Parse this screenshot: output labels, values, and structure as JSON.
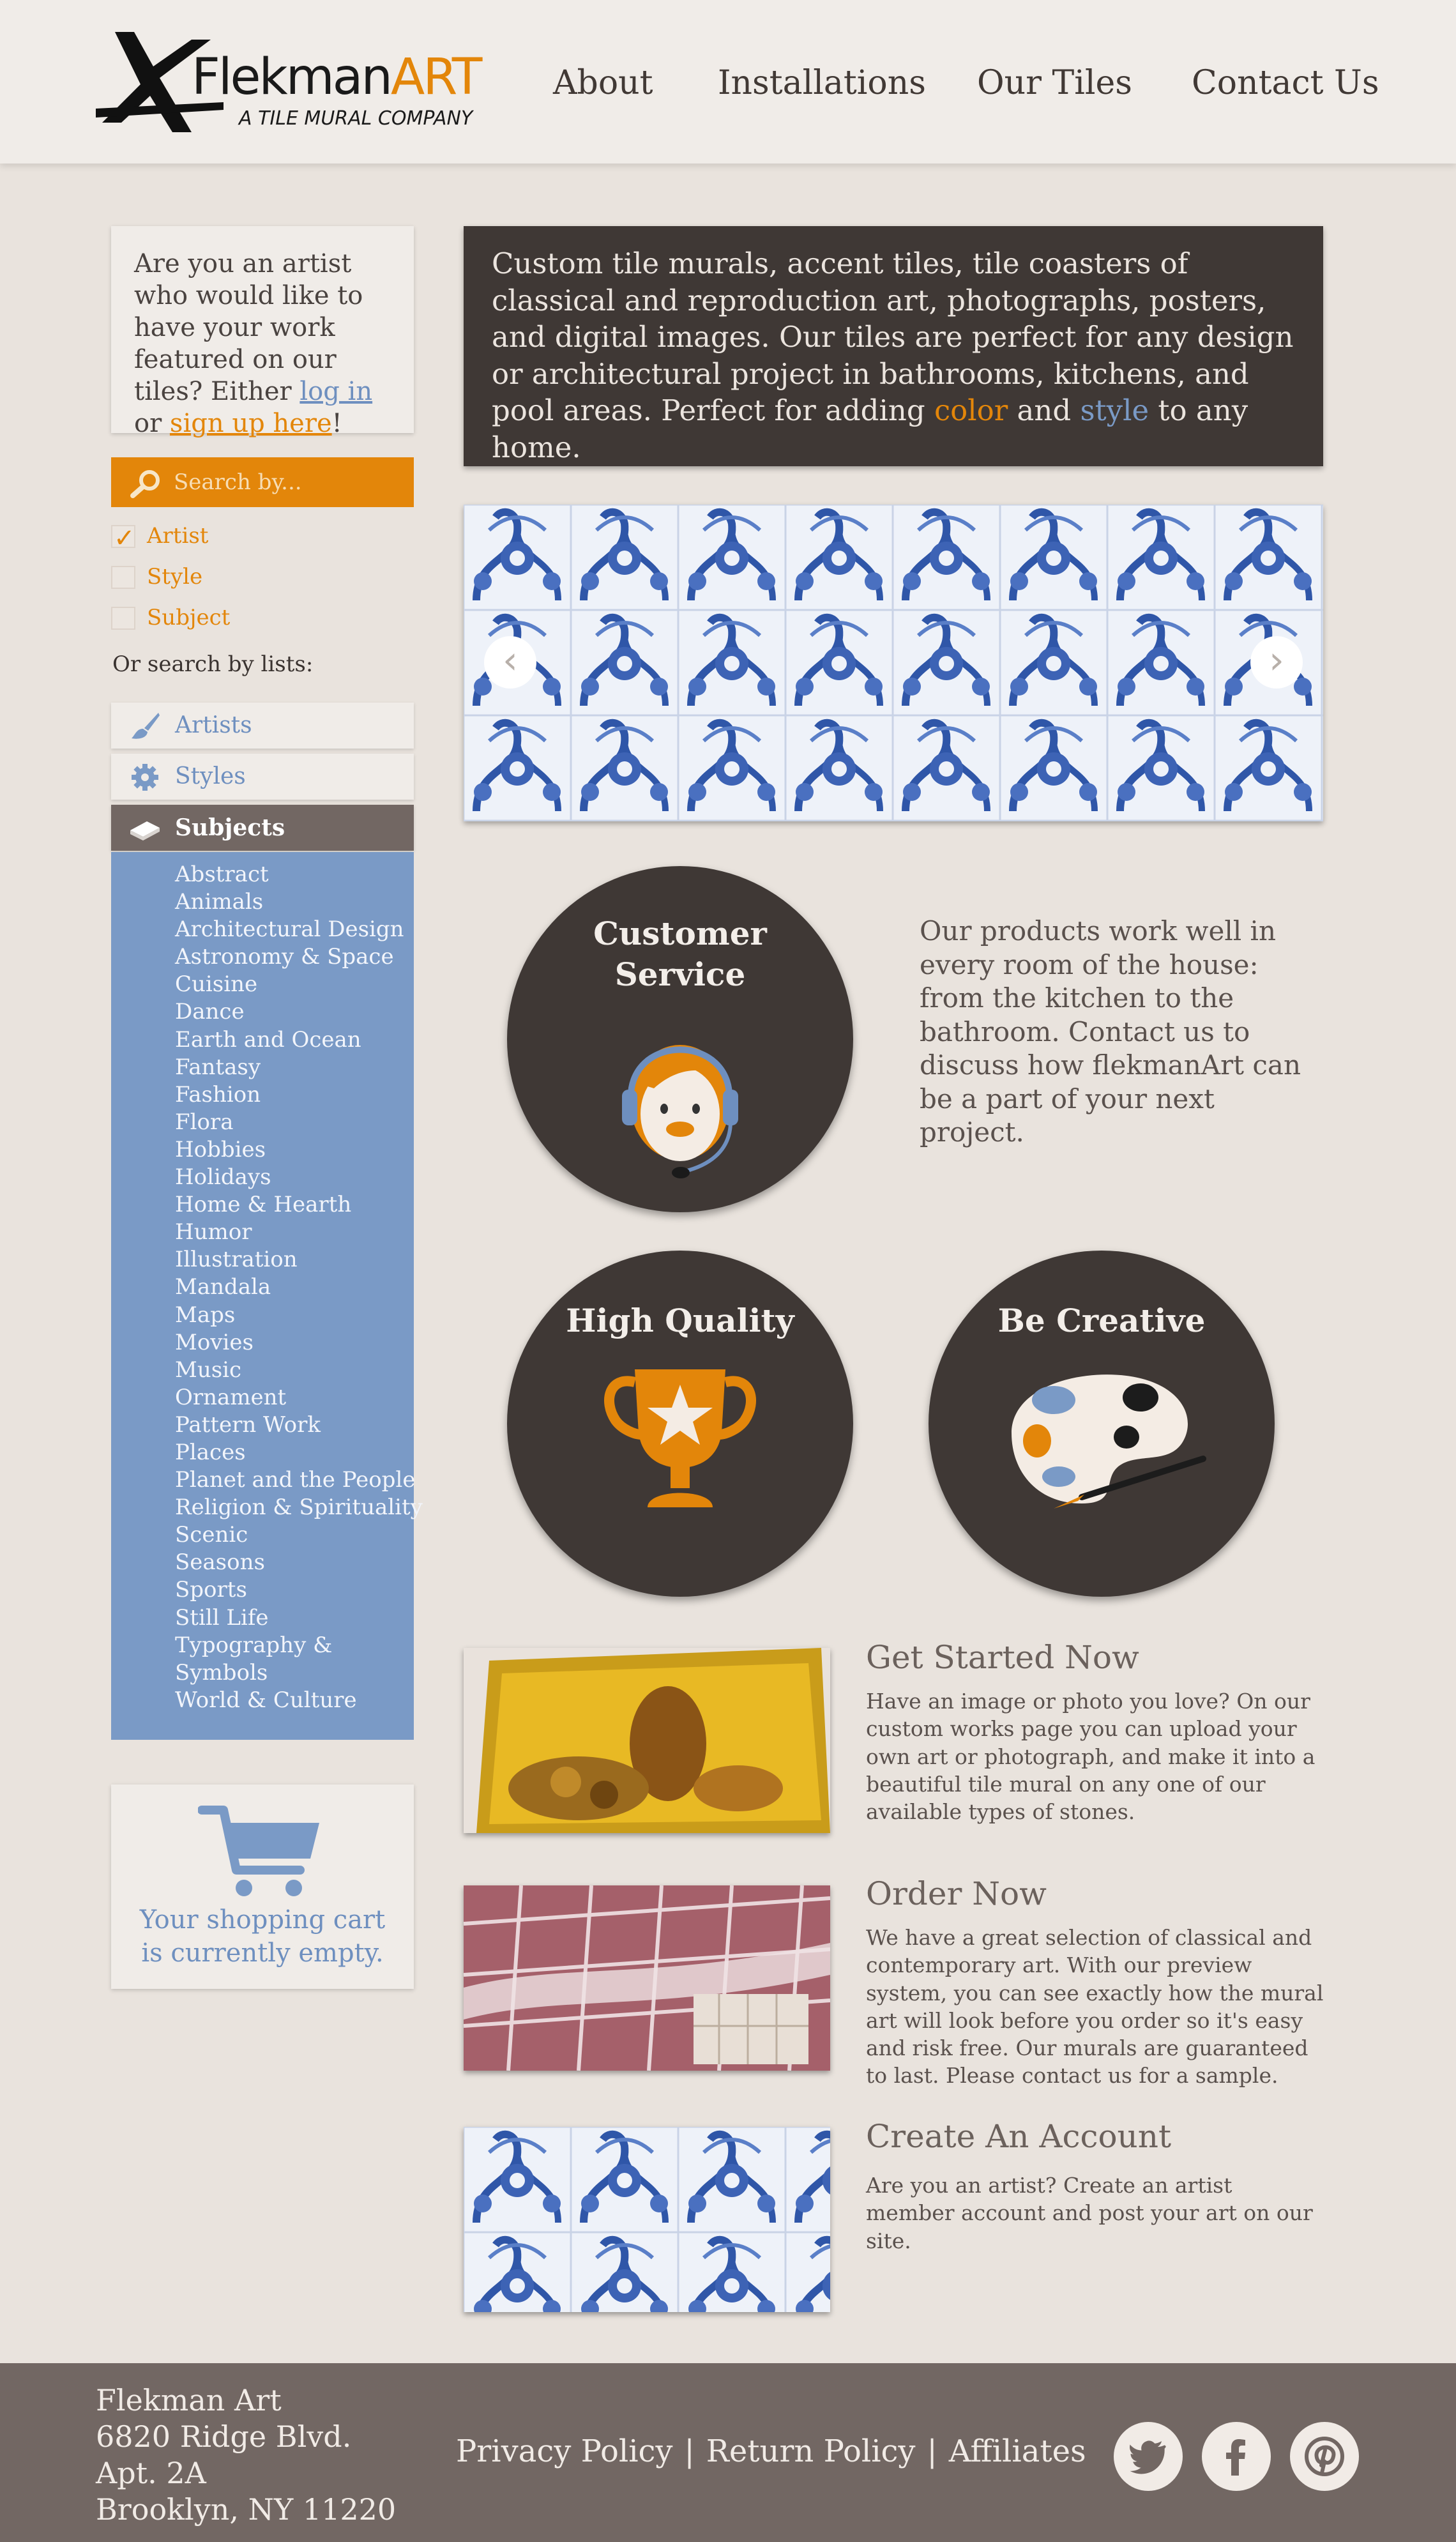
{
  "header": {
    "logo": {
      "word_main": "Flekman",
      "word_accent": "ART",
      "tagline": "A TILE MURAL COMPANY"
    },
    "nav": [
      "About",
      "Installations",
      "Our Tiles",
      "Contact Us"
    ]
  },
  "sidebar": {
    "artist_box": {
      "text_before": "Are you an artist who would like to have your work featured on our tiles? Either ",
      "login": "log in",
      "middle": " or ",
      "signup": "sign up here",
      "end": "!"
    },
    "search": {
      "placeholder": "Search by..."
    },
    "filters": [
      {
        "label": "Artist",
        "checked": true
      },
      {
        "label": "Style",
        "checked": false
      },
      {
        "label": "Subject",
        "checked": false
      }
    ],
    "or_search_label": "Or search by lists:",
    "lists": [
      {
        "label": "Artists",
        "icon": "paintbrush-icon",
        "active": false
      },
      {
        "label": "Styles",
        "icon": "gear-icon",
        "active": false
      },
      {
        "label": "Subjects",
        "icon": "book-icon",
        "active": true
      }
    ],
    "subjects": [
      "Abstract",
      "Animals",
      "Architectural Design",
      "Astronomy & Space",
      "Cuisine",
      "Dance",
      "Earth and Ocean",
      "Fantasy",
      "Fashion",
      "Flora",
      "Hobbies",
      "Holidays",
      "Home & Hearth",
      "Humor",
      "Illustration",
      "Mandala",
      "Maps",
      "Movies",
      "Music",
      "Ornament",
      "Pattern Work",
      "Places",
      "Planet and the People",
      "Religion & Spirituality",
      "Scenic",
      "Seasons",
      "Sports",
      "Still Life",
      "Typography &",
      "Symbols",
      "World & Culture"
    ],
    "cart": {
      "line1": "Your shopping cart",
      "line2": "is currently empty."
    }
  },
  "main": {
    "intro": {
      "text_before": "Custom tile murals, accent tiles, tile coasters of classical and reproduction art, photographs, posters, and digital images. Our tiles are perfect for any design or architectural project in bathrooms, kitchens, and pool areas. Perfect for adding ",
      "color_word": "color",
      "and_word": " and ",
      "style_word": "style",
      "text_after": " to any home."
    },
    "slider": {
      "prev": "‹",
      "next": "›"
    },
    "circles": {
      "customer_service": {
        "line1": "Customer",
        "line2": "Service"
      },
      "high_quality": "High Quality",
      "be_creative": "Be Creative"
    },
    "customer_service_text": "Our products work well in every room of the house: from the kitchen to the bathroom. Contact us to discuss how flekmanArt can be a part of your next project.",
    "features": [
      {
        "title": "Get Started Now",
        "body": "Have an image or photo you love? On our custom works page you can upload your own art or photograph, and make it into a beautiful tile mural on any one of our available types of stones."
      },
      {
        "title": "Order Now",
        "body": "We have a great selection of classical and contemporary art. With our preview system, you can see exactly how the mural art will look before you order so it's easy and risk free. Our murals are guaranteed to last. Please contact us for a sample."
      },
      {
        "title": "Create An Account",
        "body": "Are you an artist? Create an artist member account and post your art on our site."
      }
    ]
  },
  "footer": {
    "address": [
      "Flekman Art",
      "6820 Ridge Blvd.",
      "Apt. 2A",
      "Brooklyn, NY 11220"
    ],
    "links": [
      "Privacy Policy",
      "Return Policy",
      "Affiliates"
    ],
    "separator": "|",
    "social": [
      "twitter-icon",
      "facebook-icon",
      "pinterest-icon"
    ]
  },
  "colors": {
    "accent_orange": "#e3860a",
    "accent_blue": "#7a9ac6",
    "dark": "#3f3835",
    "footer": "#726763",
    "background": "#e9e3dd"
  }
}
